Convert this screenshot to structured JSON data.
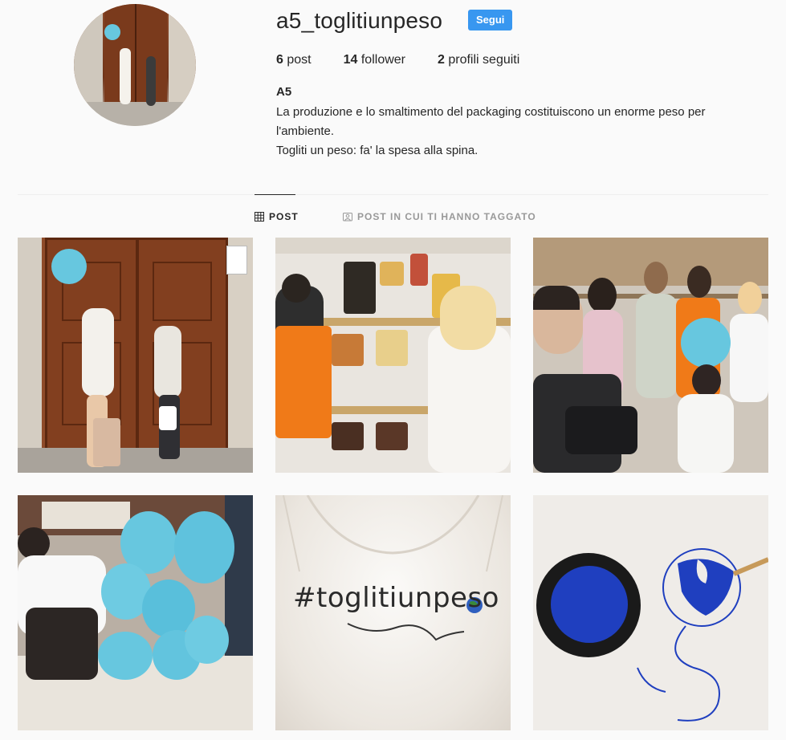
{
  "profile": {
    "username": "a5_toglitiunpeso",
    "follow_label": "Segui",
    "stats": [
      {
        "count": "6",
        "label": "post"
      },
      {
        "count": "14",
        "label": "follower"
      },
      {
        "count": "2",
        "label": "profili seguiti"
      }
    ],
    "full_name": "A5",
    "bio_lines": [
      "La produzione e lo smaltimento del packaging costituiscono un enorme peso per l'ambiente.",
      "Togliti un peso: fa' la spesa alla spina."
    ]
  },
  "tabs": [
    {
      "label": "POST",
      "icon": "grid-icon",
      "active": true
    },
    {
      "label": "POST IN CUI TI HANNO TAGGATO",
      "icon": "tagged-icon",
      "active": false
    }
  ],
  "posts": [
    {
      "caption_text": ""
    },
    {
      "caption_text": ""
    },
    {
      "caption_text": ""
    },
    {
      "caption_text": ""
    },
    {
      "caption_text": "#toglitiunpeso"
    },
    {
      "caption_text": ""
    }
  ],
  "colors": {
    "accent": "#3897f0",
    "balloon": "#67c7df",
    "paint_blue": "#1f3fbf"
  }
}
